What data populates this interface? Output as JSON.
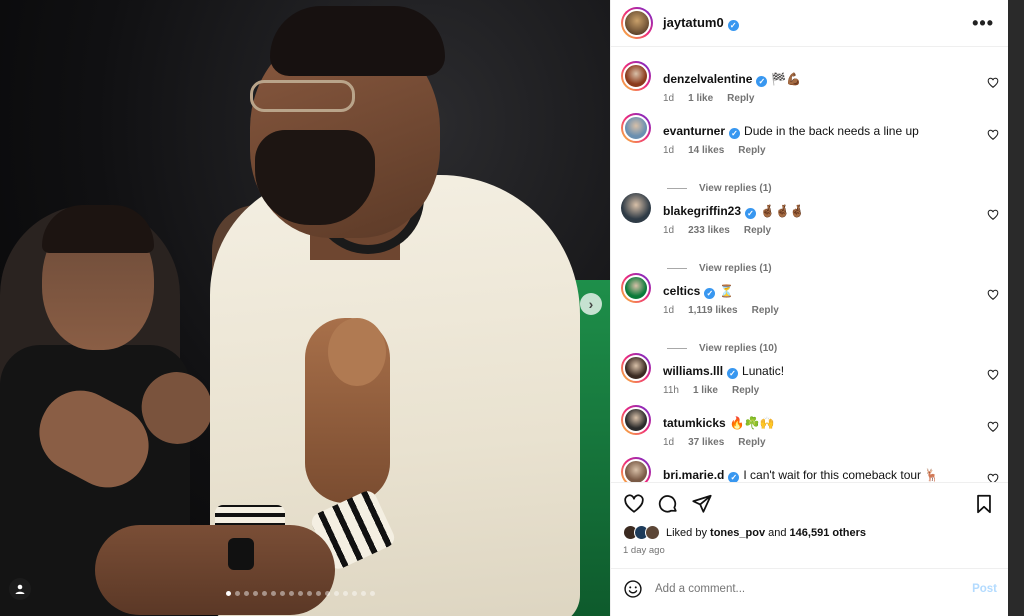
{
  "post": {
    "author": "jaytatum0",
    "carousel": {
      "slides": 17,
      "active": 0
    }
  },
  "comments": [
    {
      "user": "denzelvalentine",
      "verified": true,
      "text": "🏁💪🏾",
      "time": "1d",
      "likes": "1 like",
      "reply": "Reply",
      "avatar_color": "#8b3a1c",
      "story_ring": true
    },
    {
      "user": "evanturner",
      "verified": true,
      "text": "Dude in the back needs a line up",
      "time": "1d",
      "likes": "14 likes",
      "reply": "Reply",
      "avatar_color": "#6a8fb0",
      "story_ring": true,
      "view_replies": "View replies (1)"
    },
    {
      "user": "blakegriffin23",
      "verified": true,
      "text": "🤞🏾🤞🏾🤞🏾",
      "time": "1d",
      "likes": "233 likes",
      "reply": "Reply",
      "avatar_color": "#2f3b46",
      "story_ring": false,
      "view_replies": "View replies (1)"
    },
    {
      "user": "celtics",
      "verified": true,
      "text": "⏳",
      "time": "1d",
      "likes": "1,119 likes",
      "reply": "Reply",
      "avatar_color": "#0b7a3a",
      "story_ring": true,
      "view_replies": "View replies (10)"
    },
    {
      "user": "williams.lll",
      "verified": true,
      "text": "Lunatic!",
      "time": "11h",
      "likes": "1 like",
      "reply": "Reply",
      "avatar_color": "#3a2a22",
      "story_ring": true
    },
    {
      "user": "tatumkicks",
      "verified": false,
      "text": "🔥☘️🙌",
      "time": "1d",
      "likes": "37 likes",
      "reply": "Reply",
      "avatar_color": "#2b2b2b",
      "story_ring": true
    },
    {
      "user": "bri.marie.d",
      "verified": true,
      "text": "I can't wait for this comeback tour 🦌",
      "time": "",
      "likes": "",
      "reply": "",
      "avatar_color": "#7a5a46",
      "story_ring": true
    }
  ],
  "likes": {
    "prefix": "Liked by",
    "user": "tones_pov",
    "and": "and",
    "others": "146,591 others"
  },
  "time_ago": "1 day ago",
  "add_comment": {
    "placeholder": "Add a comment...",
    "post_label": "Post"
  },
  "colors": {
    "verified": "#3897f0",
    "muted": "#737373",
    "post_disabled": "#b3dbff"
  }
}
